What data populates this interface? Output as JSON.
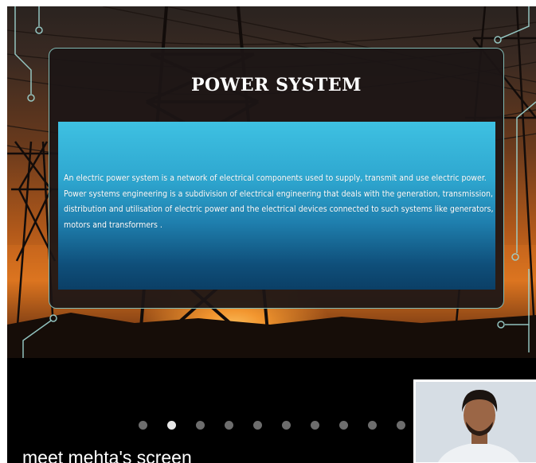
{
  "presentation": {
    "title": "POWER SYSTEM",
    "body": "An electric power system is a network of electrical components used to supply, transmit and use electric power. Power systems engineering is a subdivision of electrical engineering that deals with the generation, transmission, distribution and utilisation of electric power and the electrical devices connected to such systems like generators, motors and transformers ."
  },
  "carousel": {
    "total": 10,
    "active_index": 1
  },
  "screen_share": {
    "owner_label": "meet mehta's screen"
  },
  "colors": {
    "stage_background": "#000000",
    "panel_top": "#3ec1e2",
    "panel_bottom": "#0b3f66",
    "dot_active": "#e8e8e8",
    "dot_inactive": "#6d6d6d"
  }
}
